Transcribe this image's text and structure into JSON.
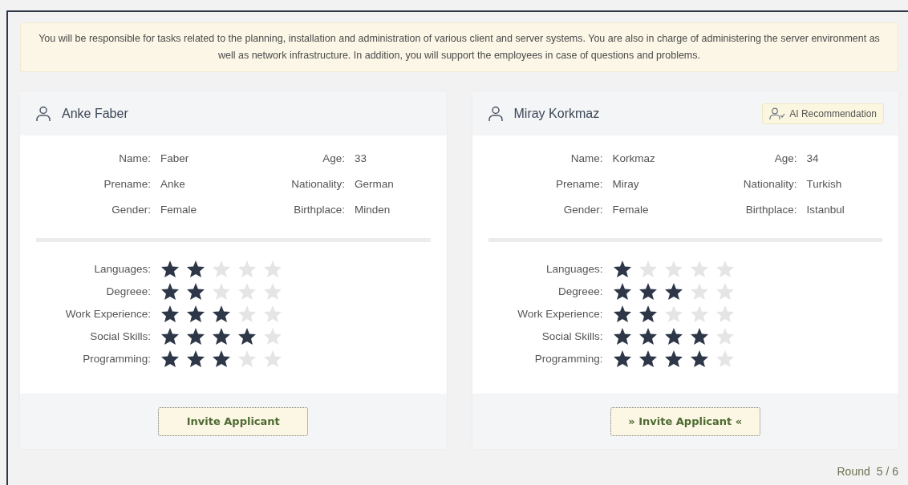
{
  "description": "You will be responsible for tasks related to the planning, installation and administration of various client and server systems. You are also in charge of administering the server environment as well as network infrastructure. In addition, you will support the employees in case of questions and problems.",
  "applicants": [
    {
      "full_name": "Anke Faber",
      "info": [
        {
          "label": "Name:",
          "value": "Faber"
        },
        {
          "label": "Age:",
          "value": "33"
        },
        {
          "label": "Prename:",
          "value": "Anke"
        },
        {
          "label": "Nationality:",
          "value": "German"
        },
        {
          "label": "Gender:",
          "value": "Female"
        },
        {
          "label": "Birthplace:",
          "value": "Minden"
        }
      ],
      "skills": [
        {
          "label": "Languages:",
          "stars": 2
        },
        {
          "label": "Degreee:",
          "stars": 2
        },
        {
          "label": "Work Experience:",
          "stars": 3
        },
        {
          "label": "Social Skills:",
          "stars": 4
        },
        {
          "label": "Programming:",
          "stars": 3
        }
      ],
      "button": "Invite Applicant"
    },
    {
      "full_name": "Miray Korkmaz",
      "badge": "AI Recommendation",
      "info": [
        {
          "label": "Name:",
          "value": "Korkmaz"
        },
        {
          "label": "Age:",
          "value": "34"
        },
        {
          "label": "Prename:",
          "value": "Miray"
        },
        {
          "label": "Nationality:",
          "value": "Turkish"
        },
        {
          "label": "Gender:",
          "value": "Female"
        },
        {
          "label": "Birthplace:",
          "value": "Istanbul"
        }
      ],
      "skills": [
        {
          "label": "Languages:",
          "stars": 1
        },
        {
          "label": "Degreee:",
          "stars": 3
        },
        {
          "label": "Work Experience:",
          "stars": 2
        },
        {
          "label": "Social Skills:",
          "stars": 4
        },
        {
          "label": "Programming:",
          "stars": 4
        }
      ],
      "button": "» Invite Applicant «"
    }
  ],
  "round": {
    "label": "Round",
    "value": "5 / 6"
  }
}
